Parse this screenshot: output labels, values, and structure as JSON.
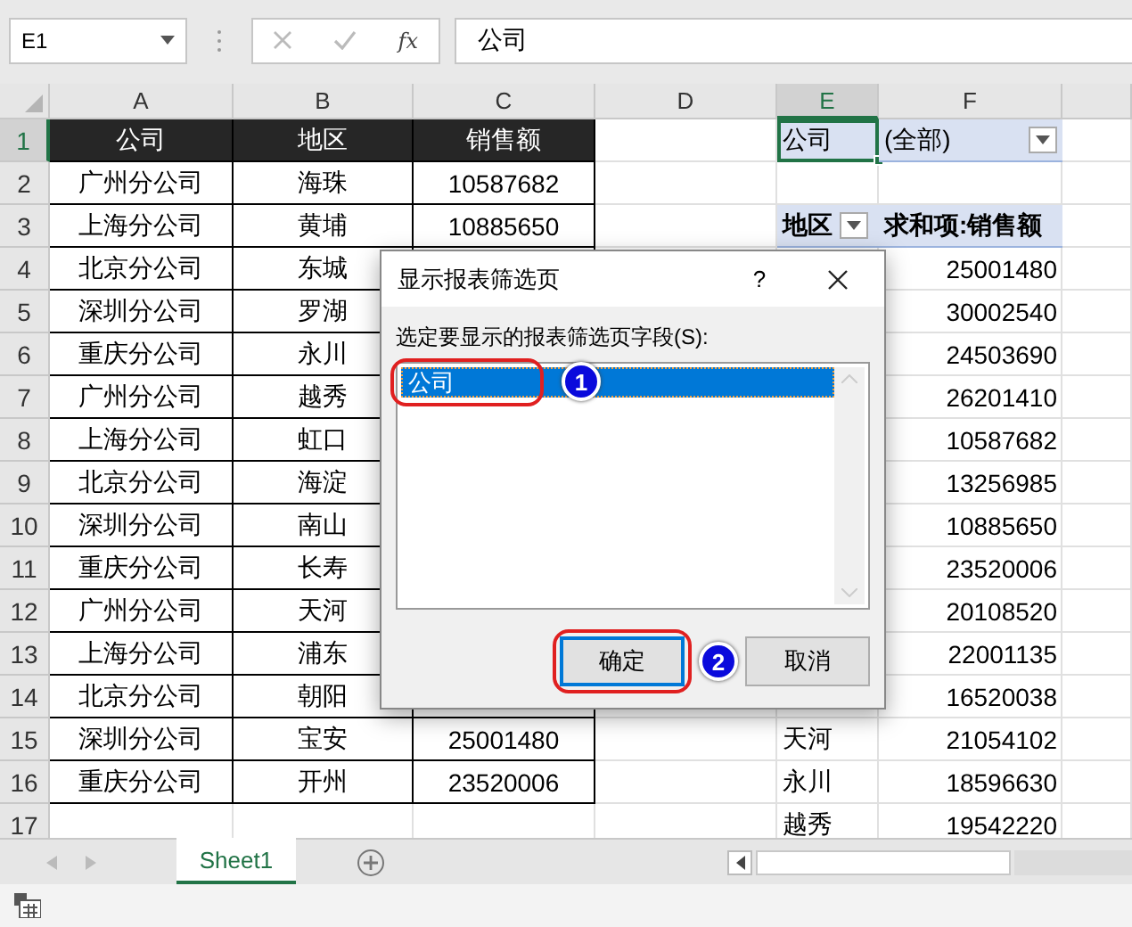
{
  "formula_bar": {
    "name_box": "E1",
    "function_label": "fx",
    "formula": "公司"
  },
  "columns": [
    {
      "label": "A",
      "selected": false
    },
    {
      "label": "B",
      "selected": false
    },
    {
      "label": "C",
      "selected": false
    },
    {
      "label": "D",
      "selected": false
    },
    {
      "label": "E",
      "selected": true
    },
    {
      "label": "F",
      "selected": false
    }
  ],
  "rows": [
    {
      "num": "1",
      "selected": true,
      "table": {
        "kind": "header",
        "company": "公司",
        "region": "地区",
        "sales": "销售额"
      },
      "pivot": {
        "kind": "filter",
        "label": "公司",
        "value": "(全部)",
        "selected": true
      }
    },
    {
      "num": "2",
      "selected": false,
      "table": {
        "kind": "data",
        "company": "广州分公司",
        "region": "海珠",
        "sales": "10587682"
      }
    },
    {
      "num": "3",
      "selected": false,
      "table": {
        "kind": "data",
        "company": "上海分公司",
        "region": "黄埔",
        "sales": "10885650"
      },
      "pivot": {
        "kind": "header",
        "label": "地区",
        "value": "求和项:销售额"
      }
    },
    {
      "num": "4",
      "selected": false,
      "table": {
        "kind": "data",
        "company": "北京分公司",
        "region": "东城"
      },
      "pivot": {
        "kind": "item",
        "value": "25001480"
      }
    },
    {
      "num": "5",
      "selected": false,
      "table": {
        "kind": "data",
        "company": "深圳分公司",
        "region": "罗湖"
      },
      "pivot": {
        "kind": "item",
        "value": "30002540"
      }
    },
    {
      "num": "6",
      "selected": false,
      "table": {
        "kind": "data",
        "company": "重庆分公司",
        "region": "永川"
      },
      "pivot": {
        "kind": "item",
        "value": "24503690"
      }
    },
    {
      "num": "7",
      "selected": false,
      "table": {
        "kind": "data",
        "company": "广州分公司",
        "region": "越秀"
      },
      "pivot": {
        "kind": "item",
        "value": "26201410"
      }
    },
    {
      "num": "8",
      "selected": false,
      "table": {
        "kind": "data",
        "company": "上海分公司",
        "region": "虹口"
      },
      "pivot": {
        "kind": "item",
        "value": "10587682"
      }
    },
    {
      "num": "9",
      "selected": false,
      "table": {
        "kind": "data",
        "company": "北京分公司",
        "region": "海淀"
      },
      "pivot": {
        "kind": "item",
        "value": "13256985"
      }
    },
    {
      "num": "10",
      "selected": false,
      "table": {
        "kind": "data",
        "company": "深圳分公司",
        "region": "南山"
      },
      "pivot": {
        "kind": "item",
        "value": "10885650"
      }
    },
    {
      "num": "11",
      "selected": false,
      "table": {
        "kind": "data",
        "company": "重庆分公司",
        "region": "长寿"
      },
      "pivot": {
        "kind": "item",
        "value": "23520006"
      }
    },
    {
      "num": "12",
      "selected": false,
      "table": {
        "kind": "data",
        "company": "广州分公司",
        "region": "天河"
      },
      "pivot": {
        "kind": "item",
        "value": "20108520"
      }
    },
    {
      "num": "13",
      "selected": false,
      "table": {
        "kind": "data",
        "company": "上海分公司",
        "region": "浦东"
      },
      "pivot": {
        "kind": "item",
        "value": "22001135"
      }
    },
    {
      "num": "14",
      "selected": false,
      "table": {
        "kind": "data",
        "company": "北京分公司",
        "region": "朝阳"
      },
      "pivot": {
        "kind": "item",
        "value": "16520038"
      }
    },
    {
      "num": "15",
      "selected": false,
      "table": {
        "kind": "data",
        "company": "深圳分公司",
        "region": "宝安",
        "sales": "25001480"
      },
      "pivot": {
        "kind": "item",
        "label": "天河",
        "value": "21054102"
      }
    },
    {
      "num": "16",
      "selected": false,
      "table": {
        "kind": "data",
        "company": "重庆分公司",
        "region": "开州",
        "sales": "23520006"
      },
      "pivot": {
        "kind": "item",
        "label": "永川",
        "value": "18596630"
      }
    },
    {
      "num": "17",
      "selected": false,
      "pivot": {
        "kind": "item",
        "label": "越秀",
        "value": "19542220"
      }
    }
  ],
  "dialog": {
    "title": "显示报表筛选页",
    "help": "?",
    "prompt": "选定要显示的报表筛选页字段(S):",
    "fields": [
      {
        "label": "公司",
        "selected": true
      }
    ],
    "buttons": [
      {
        "label": "确定",
        "default": true
      },
      {
        "label": "取消",
        "default": false
      }
    ],
    "callouts": [
      "1",
      "2"
    ]
  },
  "sheet_tabs": [
    {
      "label": "Sheet1",
      "selected": true
    }
  ]
}
